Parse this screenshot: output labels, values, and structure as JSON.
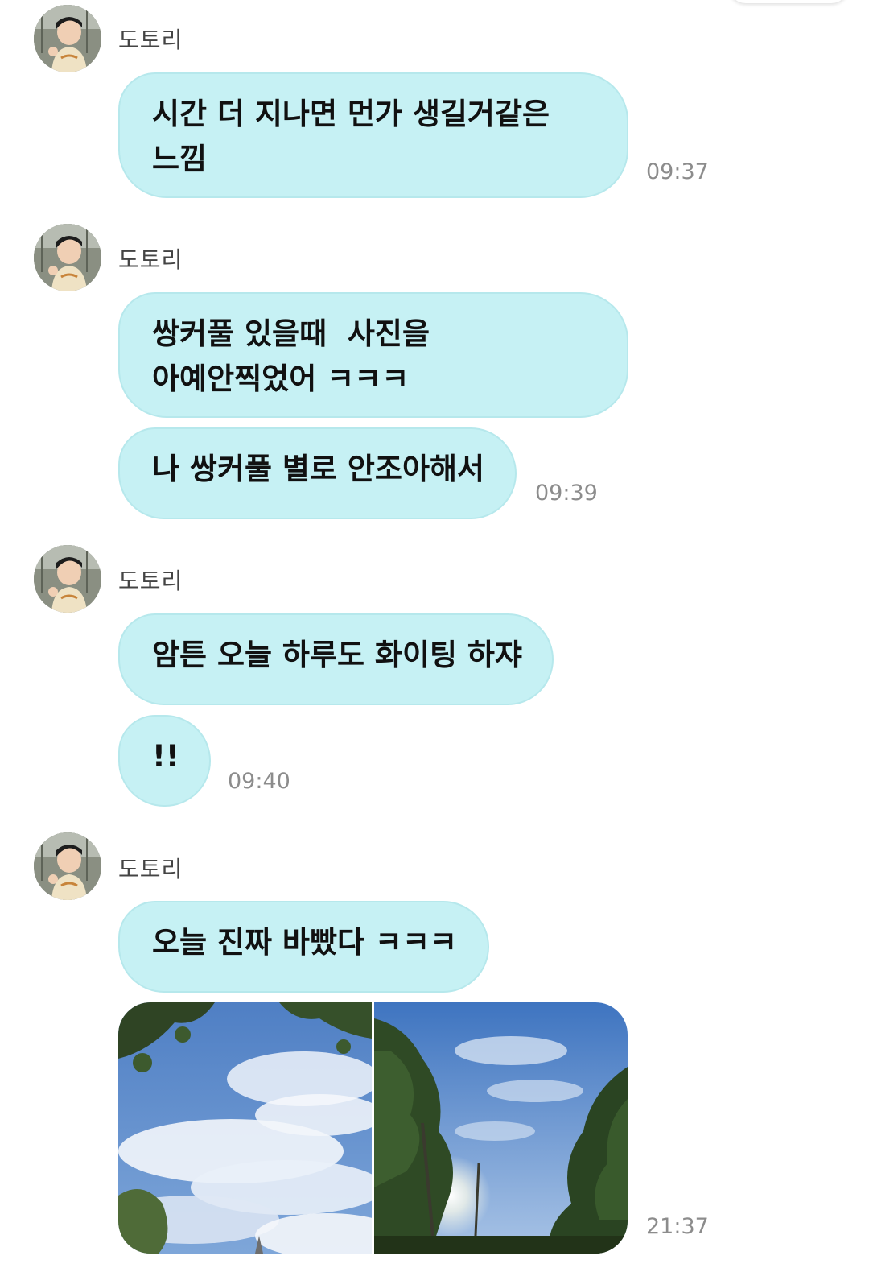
{
  "chat": {
    "sender_name": "도토리",
    "groups": [
      {
        "messages": [
          "시간 더 지나면 먼가 생길거같은\n느낌"
        ],
        "time": "09:37"
      },
      {
        "messages": [
          "쌍커풀 있을때  사진을\n아예안찍었어 ㅋㅋㅋ",
          "나 쌍커풀 별로 안조아해서"
        ],
        "time": "09:39"
      },
      {
        "messages": [
          "암튼 오늘 하루도 화이팅 하쟈",
          "!!"
        ],
        "time": "09:40"
      },
      {
        "messages": [
          "오늘 진짜 바빴다 ㅋㅋㅋ"
        ],
        "photos": [
          "sky-clouds-photo",
          "trees-sun-photo"
        ],
        "time": "21:37"
      }
    ]
  },
  "colors": {
    "bubble": "#c6f1f4",
    "bubble_border": "#b6e8ec",
    "time_text": "#8c8c8c",
    "sender_text": "#444444"
  },
  "icons": {
    "avatar": "child-photo-avatar"
  }
}
